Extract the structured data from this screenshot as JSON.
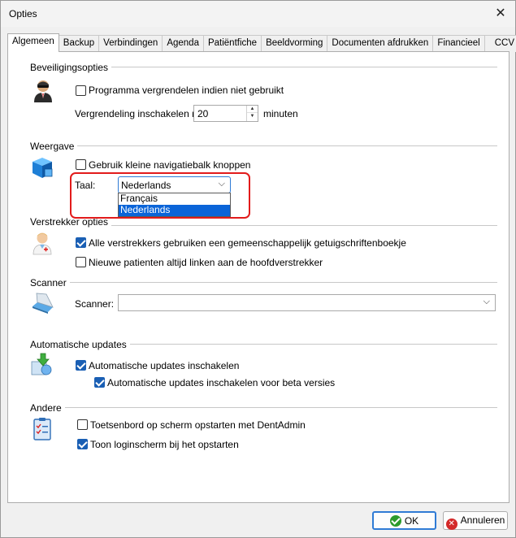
{
  "window": {
    "title": "Opties",
    "close_glyph": "✕"
  },
  "tabs": [
    {
      "label": "Algemeen",
      "active": true
    },
    {
      "label": "Backup"
    },
    {
      "label": "Verbindingen"
    },
    {
      "label": "Agenda"
    },
    {
      "label": "Patiëntfiche"
    },
    {
      "label": "Beeldvorming"
    },
    {
      "label": "Documenten afdrukken"
    },
    {
      "label": "Financieel"
    },
    {
      "label": "CCV"
    }
  ],
  "beveiliging": {
    "title": "Beveiligingsopties",
    "icon": "security-agent-icon",
    "lock_label": "Programma vergrendelen indien niet gebruikt",
    "lock_checked": false,
    "after_label": "Vergrendeling inschakelen na",
    "minutes_value": "20",
    "minutes_label": "minuten"
  },
  "weergave": {
    "title": "Weergave",
    "icon": "3d-box-icon",
    "small_nav_label": "Gebruik kleine navigatiebalk knoppen",
    "small_nav_checked": false,
    "language_label": "Taal:",
    "language_value": "Nederlands",
    "language_options": [
      "Français",
      "Nederlands"
    ],
    "selected_option": "Nederlands"
  },
  "verstrekker": {
    "title": "Verstrekker opties",
    "icon": "doctor-icon",
    "shared_label": "Alle verstrekkers gebruiken een gemeenschappelijk getuigschriftenboekje",
    "shared_checked": true,
    "link_label": "Nieuwe patienten altijd linken aan de hoofdverstrekker",
    "link_checked": false
  },
  "scanner": {
    "title": "Scanner",
    "icon": "scanner-icon",
    "scanner_label": "Scanner:",
    "scanner_value": ""
  },
  "updates": {
    "title": "Automatische updates",
    "icon": "update-icon",
    "auto_label": "Automatische updates inschakelen",
    "auto_checked": true,
    "beta_label": "Automatische updates inschakelen voor beta versies",
    "beta_checked": true
  },
  "andere": {
    "title": "Andere",
    "icon": "checklist-icon",
    "keyboard_label": "Toetsenbord op scherm opstarten met DentAdmin",
    "keyboard_checked": false,
    "login_label": "Toon loginscherm bij het opstarten",
    "login_checked": true
  },
  "footer": {
    "ok_label": "OK",
    "cancel_label": "Annuleren"
  },
  "colors": {
    "accent": "#2f7bd5",
    "highlight": "#e21b1b",
    "selection": "#0a64d8"
  }
}
